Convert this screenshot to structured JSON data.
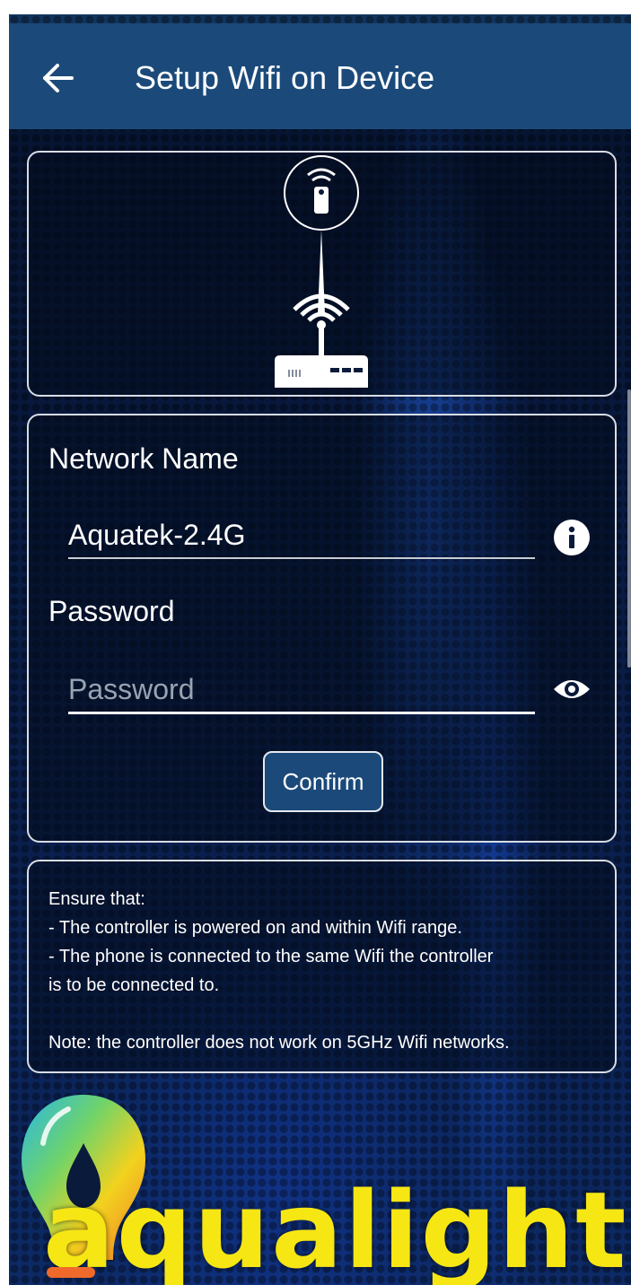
{
  "appbar": {
    "title": "Setup Wifi on Device",
    "back_icon": "arrow-left-icon"
  },
  "illustration": {
    "icons": [
      "remote-controller-icon",
      "wifi-router-icon"
    ]
  },
  "form": {
    "network_label": "Network Name",
    "network_value": "Aquatek-2.4G",
    "network_info_icon": "info-icon",
    "password_label": "Password",
    "password_value": "",
    "password_placeholder": "Password",
    "password_toggle_icon": "eye-icon",
    "confirm_label": "Confirm"
  },
  "info": {
    "lines": [
      "Ensure that:",
      "- The controller is powered on and within Wifi range.",
      "- The phone is connected to the same Wifi the controller",
      "is to be connected to."
    ],
    "note": "Note: the controller does not work on 5GHz Wifi networks."
  },
  "brand": {
    "name": "aqualight",
    "colors": {
      "appbar": "#1b4a7a",
      "logo_text": "#f5e614",
      "logo_accent": "#ef6a2a"
    }
  }
}
